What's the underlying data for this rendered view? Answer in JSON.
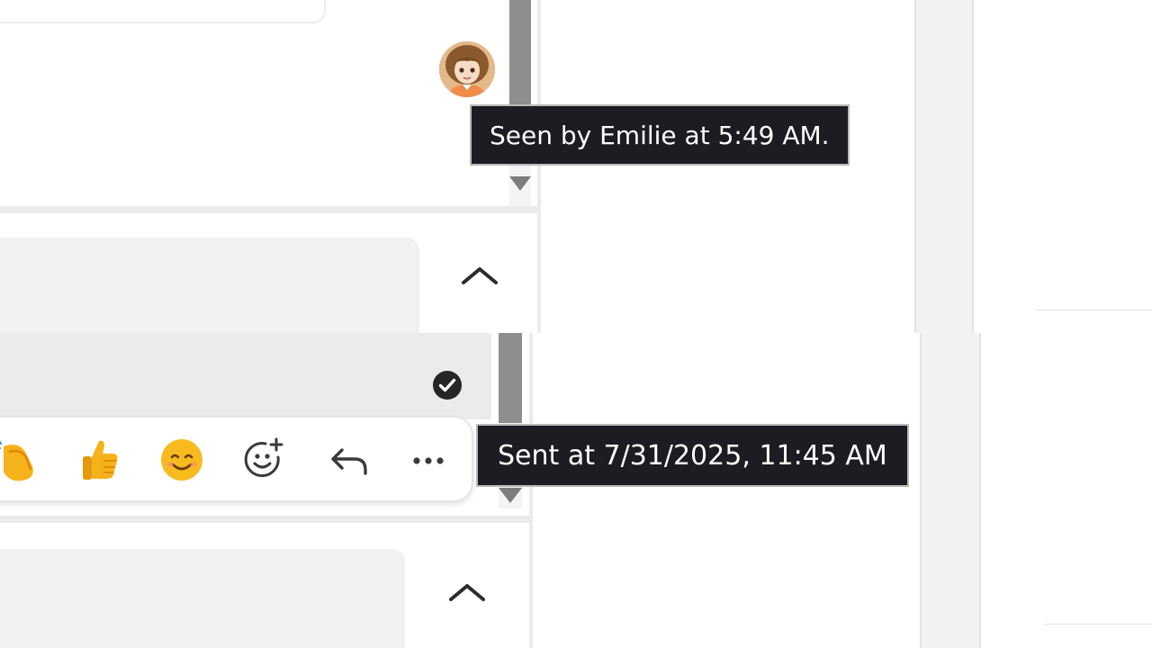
{
  "tooltips": {
    "seen": "Seen by Emilie at 5:49 AM.",
    "sent": "Sent at 7/31/2025, 11:45 AM"
  },
  "icons": {
    "avatar": "avatar-emilie",
    "read_receipt": "check-circle-icon",
    "collapse": "chevron-up-icon",
    "reactions": [
      "clapping-hands-emoji",
      "thumbs-up-emoji",
      "smiling-face-emoji"
    ],
    "actions": [
      "add-reaction-icon",
      "reply-icon",
      "more-icon"
    ]
  },
  "colors": {
    "tooltip_bg": "#1c1c22",
    "bubble_bg": "#f2f1ef",
    "scroll_thumb": "#8e8e8e"
  }
}
